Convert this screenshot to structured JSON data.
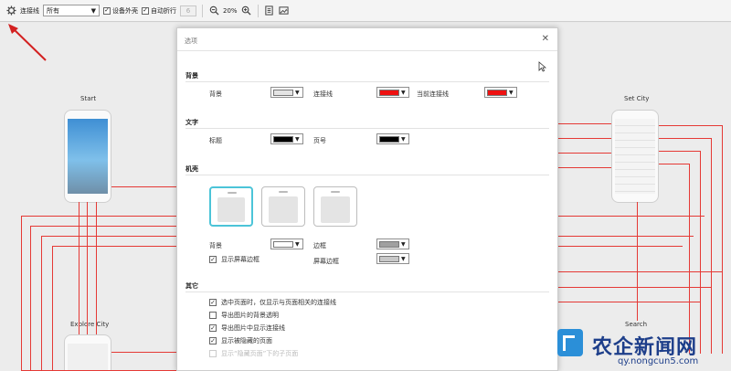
{
  "toolbar": {
    "link_label": "连接线",
    "link_select_value": "所有",
    "device_shell_label": "设备外壳",
    "auto_wrap_label": "自动折行",
    "auto_wrap_value": "6",
    "zoom_level": "20%"
  },
  "canvas": {
    "screens": {
      "start": "Start",
      "set_city": "Set City",
      "explore_city": "Explore City",
      "search": "Search"
    }
  },
  "dialog": {
    "title": "选项",
    "close_glyph": "✕",
    "sections": {
      "background": {
        "heading": "背景",
        "bg_label": "背景",
        "link_label": "连接线",
        "current_link_label": "当前连接线"
      },
      "text": {
        "heading": "文字",
        "title_label": "标题",
        "page_no_label": "页号"
      },
      "device": {
        "heading": "机壳",
        "bg_label": "背景",
        "border_label": "边框",
        "show_screen_border_label": "显示屏幕边框",
        "screen_border_label": "屏幕边框"
      },
      "other": {
        "heading": "其它",
        "options": [
          "选中页面时，仅显示与页面相关的连接线",
          "导出图片的背景透明",
          "导出图片中显示连接线",
          "显示被隐藏的页面",
          "显示“隐藏页面”下的子页面"
        ]
      }
    }
  },
  "colors": {
    "bg_swatch": "#e4e4e4",
    "link_swatch": "#ee1111",
    "current_link_swatch": "#ee1111",
    "title_swatch": "#000000",
    "page_no_swatch": "#000000",
    "device_bg_swatch": "#ffffff",
    "device_border_swatch": "#a0a0a0",
    "screen_border_swatch": "#c8c8c8",
    "wire": "#e53935",
    "selected_device": "#4cc4d8"
  },
  "watermark": {
    "name": "农企新闻网",
    "url": "qy.nongcun5.com"
  }
}
